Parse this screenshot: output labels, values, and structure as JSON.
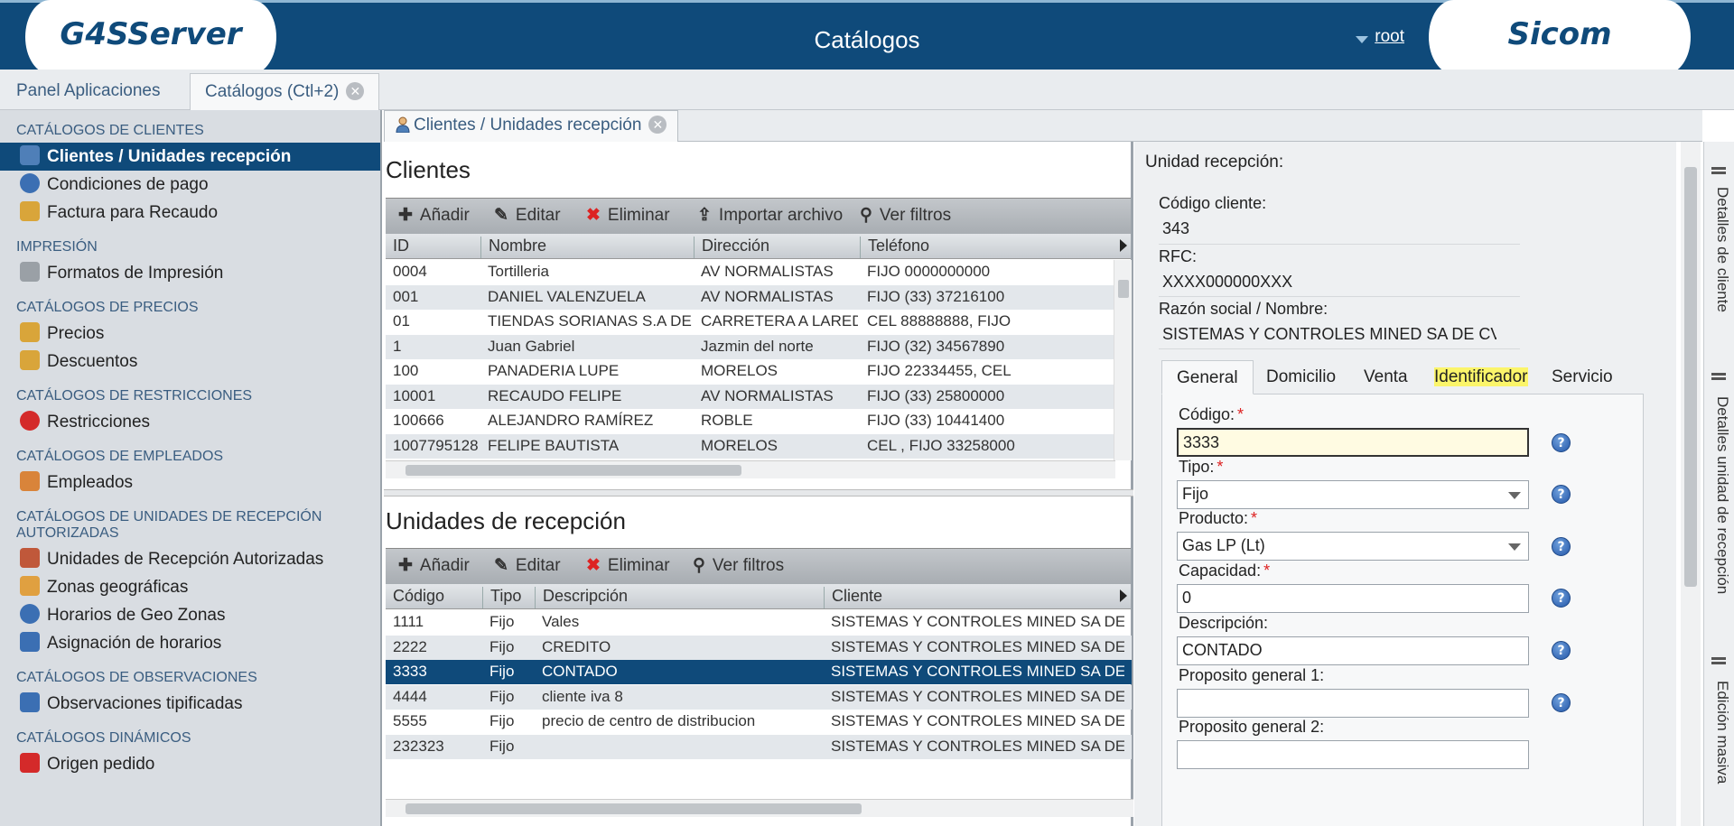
{
  "header": {
    "logo_left": "G4SServer",
    "title": "Catálogos",
    "user": "root",
    "logo_right": "Sicom"
  },
  "top_tabs": [
    {
      "label": "Panel Aplicaciones"
    },
    {
      "label": "Catálogos (Ctl+2)"
    }
  ],
  "sidebar": {
    "sections": [
      {
        "title": "CATÁLOGOS DE CLIENTES",
        "items": [
          {
            "label": "Clientes / Unidades recepción",
            "icon": "user-icon",
            "active": true
          },
          {
            "label": "Condiciones de pago",
            "icon": "clock-icon"
          },
          {
            "label": "Factura para Recaudo",
            "icon": "coins-icon"
          }
        ]
      },
      {
        "title": "IMPRESIÓN",
        "items": [
          {
            "label": "Formatos de Impresión",
            "icon": "printer-icon"
          }
        ]
      },
      {
        "title": "CATÁLOGOS DE PRECIOS",
        "items": [
          {
            "label": "Precios",
            "icon": "coins-icon"
          },
          {
            "label": "Descuentos",
            "icon": "discount-icon"
          }
        ]
      },
      {
        "title": "CATÁLOGOS DE RESTRICCIONES",
        "items": [
          {
            "label": "Restricciones",
            "icon": "no-entry-icon"
          }
        ]
      },
      {
        "title": "CATÁLOGOS DE EMPLEADOS",
        "items": [
          {
            "label": "Empleados",
            "icon": "employees-icon"
          }
        ]
      },
      {
        "title": "CATÁLOGOS DE UNIDADES DE RECEPCIÓN AUTORIZADAS",
        "items": [
          {
            "label": "Unidades de Recepción Autorizadas",
            "icon": "units-icon"
          },
          {
            "label": "Zonas geográficas",
            "icon": "zone-icon"
          },
          {
            "label": "Horarios de Geo Zonas",
            "icon": "clock-icon"
          },
          {
            "label": "Asignación de horarios",
            "icon": "calendar-icon"
          }
        ]
      },
      {
        "title": "CATÁLOGOS DE OBSERVACIONES",
        "items": [
          {
            "label": "Observaciones tipificadas",
            "icon": "notes-icon"
          }
        ]
      },
      {
        "title": "CATÁLOGOS DINÁMICOS",
        "items": [
          {
            "label": "Origen pedido",
            "icon": "origin-icon"
          }
        ]
      }
    ]
  },
  "content_tab": {
    "label": "Clientes / Unidades recepción"
  },
  "clientes": {
    "title": "Clientes",
    "toolbar": {
      "add": "Añadir",
      "edit": "Editar",
      "delete": "Eliminar",
      "import": "Importar archivo",
      "filters": "Ver filtros"
    },
    "columns": [
      "ID",
      "Nombre",
      "Dirección",
      "Teléfono"
    ],
    "rows": [
      [
        "0004",
        "Tortilleria",
        "AV NORMALISTAS",
        "FIJO 0000000000"
      ],
      [
        "001",
        "DANIEL VALENZUELA",
        "AV NORMALISTAS",
        "FIJO (33) 37216100"
      ],
      [
        "01",
        "TIENDAS SORIANAS S.A DE C.V.",
        "CARRETERA A LAREDO",
        "CEL 88888888, FIJO"
      ],
      [
        "1",
        "Juan Gabriel",
        "Jazmin del norte",
        "FIJO (32) 34567890"
      ],
      [
        "100",
        "PANADERIA LUPE",
        "MORELOS",
        "FIJO 22334455, CEL"
      ],
      [
        "10001",
        "RECAUDO FELIPE",
        "AV NORMALISTAS",
        "FIJO (33) 25800000"
      ],
      [
        "100666",
        "ALEJANDRO RAMÍREZ",
        "ROBLE",
        "FIJO (33) 10441400"
      ],
      [
        "1007795128",
        "FELIPE BAUTISTA",
        "MORELOS",
        "CEL , FIJO 33258000"
      ]
    ]
  },
  "unidades": {
    "title": "Unidades de recepción",
    "toolbar": {
      "add": "Añadir",
      "edit": "Editar",
      "delete": "Eliminar",
      "filters": "Ver filtros"
    },
    "columns": [
      "Código",
      "Tipo",
      "Descripción",
      "Cliente"
    ],
    "rows": [
      [
        "1111",
        "Fijo",
        "Vales",
        "SISTEMAS Y CONTROLES MINED SA DE CV"
      ],
      [
        "2222",
        "Fijo",
        "CREDITO",
        "SISTEMAS Y CONTROLES MINED SA DE CV"
      ],
      [
        "3333",
        "Fijo",
        "CONTADO",
        "SISTEMAS Y CONTROLES MINED SA DE CV"
      ],
      [
        "4444",
        "Fijo",
        "cliente iva 8",
        "SISTEMAS Y CONTROLES MINED SA DE CV"
      ],
      [
        "5555",
        "Fijo",
        "precio de centro de distribucion",
        "SISTEMAS Y CONTROLES MINED SA DE CV"
      ],
      [
        "232323",
        "Fijo",
        "",
        "SISTEMAS Y CONTROLES MINED SA DE CV"
      ]
    ],
    "selected_row": 2
  },
  "detail": {
    "title": "Unidad recepción:",
    "codigo_cliente_label": "Código cliente:",
    "codigo_cliente": "343",
    "rfc_label": "RFC:",
    "rfc": "XXXX000000XXX",
    "razon_label": "Razón social / Nombre:",
    "razon": "SISTEMAS Y CONTROLES MINED SA DE CV",
    "tabs": [
      "General",
      "Domicilio",
      "Venta",
      "Identificador",
      "Servicio"
    ],
    "active_tab": "General",
    "highlighted_tab": "Identificador",
    "form": {
      "codigo_label": "Código:",
      "codigo": "3333",
      "tipo_label": "Tipo:",
      "tipo": "Fijo",
      "producto_label": "Producto:",
      "producto": "Gas LP (Lt)",
      "capacidad_label": "Capacidad:",
      "capacidad": "0",
      "descripcion_label": "Descripción:",
      "descripcion": "CONTADO",
      "pg1_label": "Proposito general 1:",
      "pg1": "",
      "pg2_label": "Proposito general 2:",
      "pg2": ""
    },
    "help": "?"
  },
  "side_tabs": [
    "Detalles de cliente",
    "Detalles unidad de recepción",
    "Edición masiva"
  ],
  "colors": {
    "header": "#0f4a7a",
    "selection": "#0f4a7a",
    "highlight": "#fbf56a",
    "required": "#d22"
  }
}
